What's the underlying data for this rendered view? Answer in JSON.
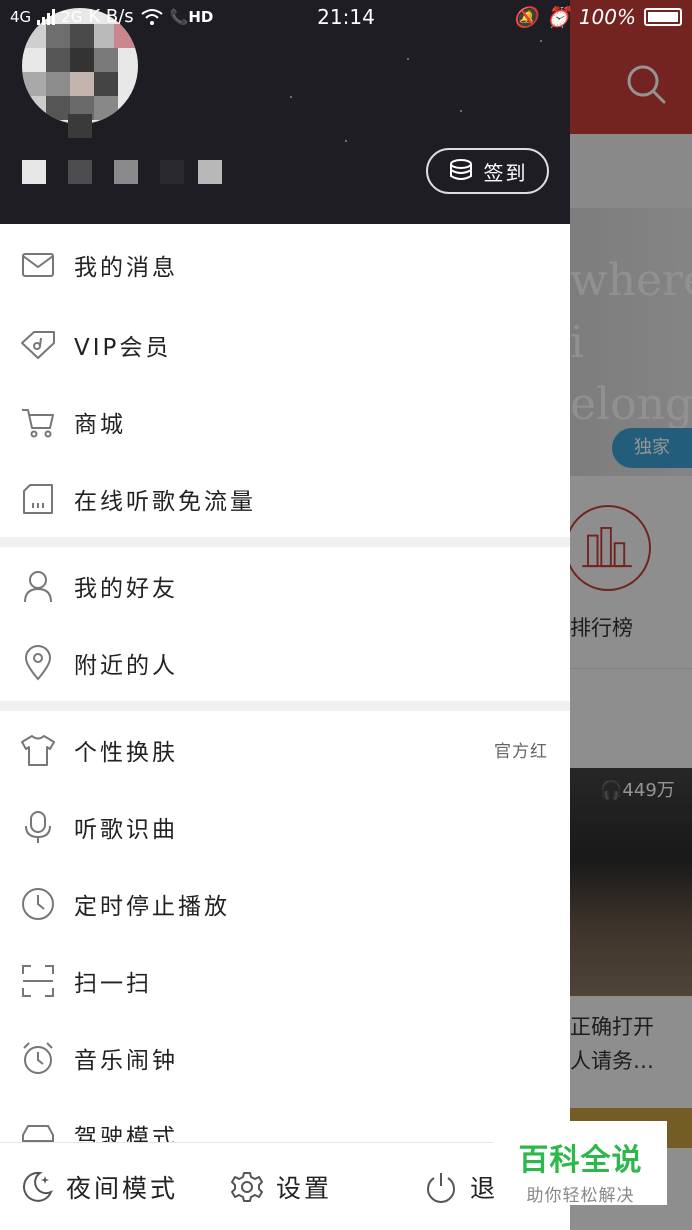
{
  "status_bar": {
    "network": "4G",
    "network2": "2G",
    "speed": "K B/s",
    "hd": "HD",
    "time": "21:14",
    "battery": "100%"
  },
  "drawer": {
    "checkin_label": "签到",
    "groups": [
      [
        {
          "icon": "mail-icon",
          "label": "我的消息"
        },
        {
          "icon": "vip-diamond-icon",
          "label": "VIP会员"
        },
        {
          "icon": "cart-icon",
          "label": "商城"
        },
        {
          "icon": "sim-card-icon",
          "label": "在线听歌免流量"
        }
      ],
      [
        {
          "icon": "person-icon",
          "label": "我的好友"
        },
        {
          "icon": "location-pin-icon",
          "label": "附近的人"
        }
      ],
      [
        {
          "icon": "tshirt-icon",
          "label": "个性换肤",
          "value": "官方红"
        },
        {
          "icon": "microphone-icon",
          "label": "听歌识曲"
        },
        {
          "icon": "clock-icon",
          "label": "定时停止播放"
        },
        {
          "icon": "scan-icon",
          "label": "扫一扫"
        },
        {
          "icon": "alarm-clock-icon",
          "label": "音乐闹钟"
        },
        {
          "icon": "car-icon",
          "label": "驾驶模式"
        }
      ]
    ],
    "bottom": {
      "night_mode": "夜间模式",
      "settings": "设置",
      "exit": "退"
    }
  },
  "background_app": {
    "banner_text": "where\ni\nelong",
    "exclusive_badge": "独家",
    "rank_label": "排行榜",
    "play_count": "449万",
    "caption": "正确打开\n人请务…"
  },
  "watermark": {
    "title": "百科全说",
    "subtitle": "助你轻松解决"
  },
  "colors": {
    "brand_red": "#c63e3a",
    "profile_bg": "#1f1d24",
    "watermark_green": "#2db84b"
  }
}
